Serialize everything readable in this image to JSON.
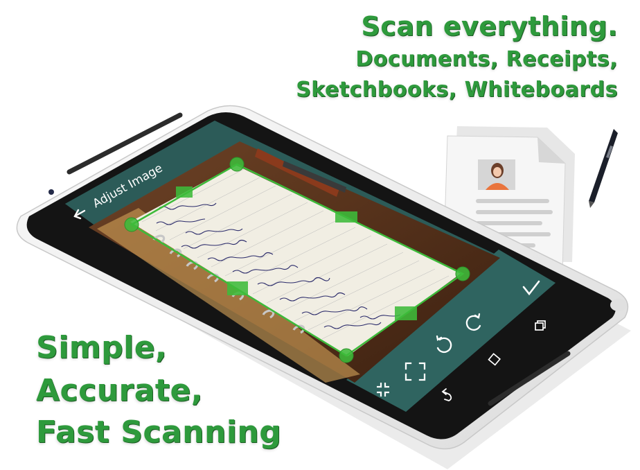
{
  "promo": {
    "headline": "Scan everything.",
    "subline_1": "Documents,  Receipts,",
    "subline_2": "Sketchbooks, Whiteboards",
    "tagline_1": "Simple,",
    "tagline_2": "Accurate,",
    "tagline_3": "Fast Scanning"
  },
  "app": {
    "header_title": "Adjust Image",
    "toolbar_color": "#2c5b58",
    "accent_color": "#3dbb3a",
    "icons": {
      "back": "arrow-left-icon",
      "confirm": "checkmark-icon",
      "rotate_left": "rotate-left-icon",
      "rotate_right": "rotate-right-icon",
      "select_all": "crop-full-icon",
      "shrink": "crop-shrink-icon"
    }
  },
  "brand": {
    "text_green": "#2e9a3c",
    "phone_white": "#f2f2f2",
    "bezel_black": "#141414"
  }
}
